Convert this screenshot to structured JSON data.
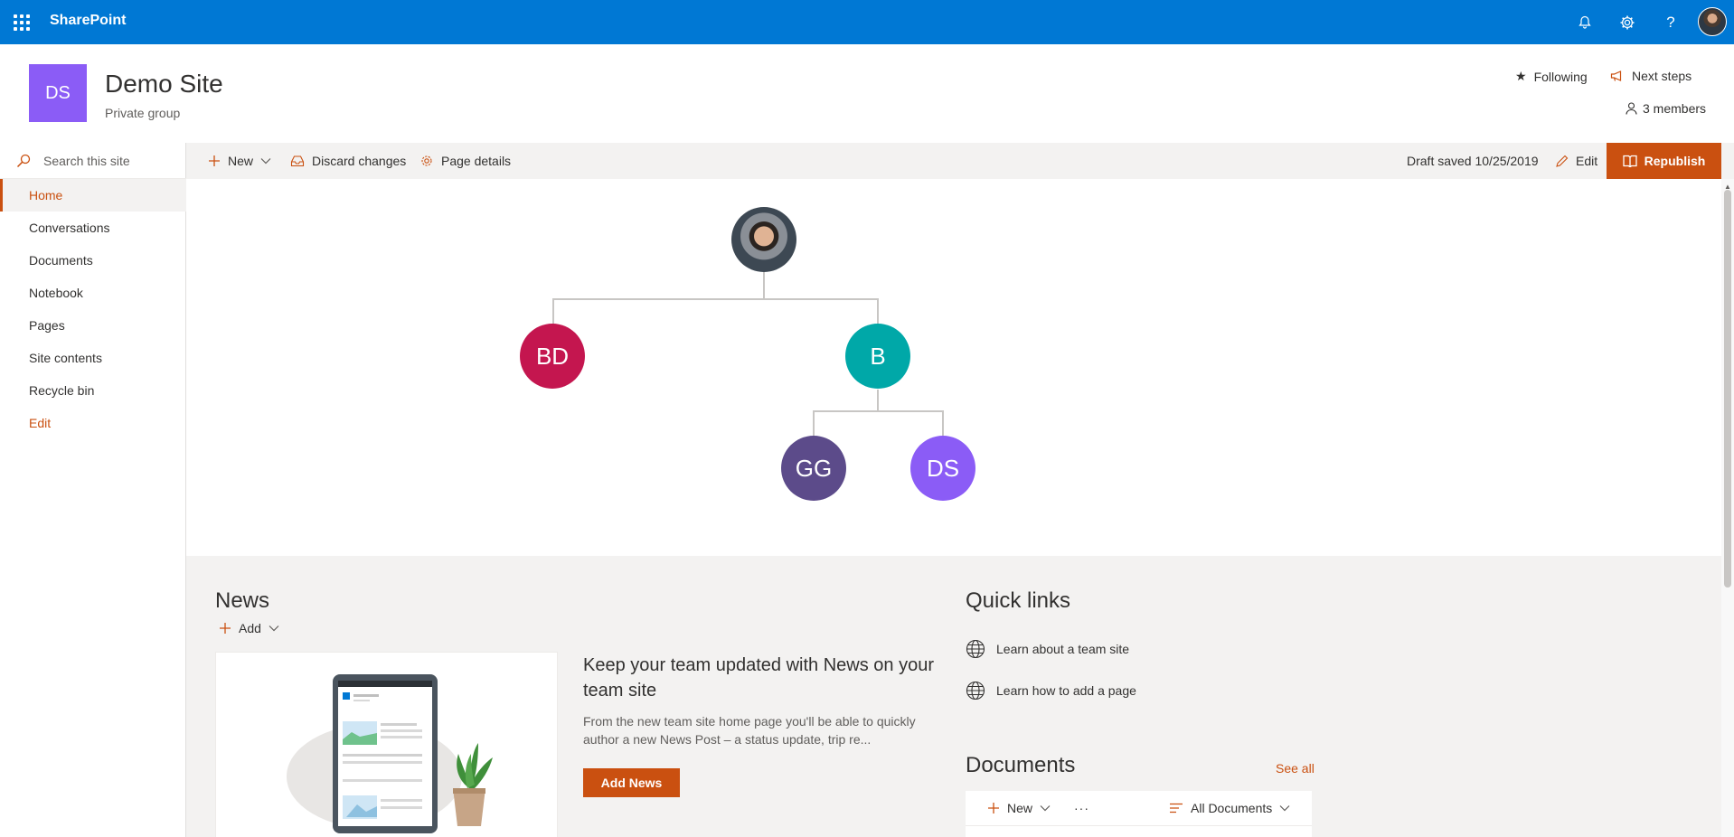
{
  "suitebar": {
    "brand": "SharePoint",
    "icons": [
      "app-launcher-icon",
      "bell-icon",
      "gear-icon",
      "help-icon",
      "avatar"
    ]
  },
  "site": {
    "logo_text": "DS",
    "title": "Demo Site",
    "subtitle": "Private group",
    "following_label": "Following",
    "next_steps_label": "Next steps",
    "members_label": "3 members"
  },
  "search": {
    "placeholder": "Search this site"
  },
  "nav": {
    "items": [
      {
        "label": "Home",
        "active": true
      },
      {
        "label": "Conversations"
      },
      {
        "label": "Documents"
      },
      {
        "label": "Notebook"
      },
      {
        "label": "Pages"
      },
      {
        "label": "Site contents"
      },
      {
        "label": "Recycle bin"
      },
      {
        "label": "Edit"
      }
    ]
  },
  "command_bar": {
    "new_label": "New",
    "discard_label": "Discard changes",
    "page_details_label": "Page details",
    "draft_status": "Draft saved 10/25/2019",
    "edit_label": "Edit",
    "republish_label": "Republish"
  },
  "org_chart": {
    "nodes": [
      {
        "initials": "BD",
        "color": "#c4164f"
      },
      {
        "initials": "B",
        "color": "#00a8a8"
      },
      {
        "initials": "GG",
        "color": "#5c4b8a"
      },
      {
        "initials": "DS",
        "color": "#8b5cf6"
      }
    ]
  },
  "news": {
    "title": "News",
    "add_label": "Add",
    "headline": "Keep your team updated with News on your team site",
    "description": "From the new team site home page you'll be able to quickly author a new News Post – a status update, trip re...",
    "add_news_label": "Add News"
  },
  "quick_links": {
    "title": "Quick links",
    "items": [
      {
        "label": "Learn about a team site"
      },
      {
        "label": "Learn how to add a page"
      }
    ]
  },
  "documents": {
    "title": "Documents",
    "see_all_label": "See all",
    "new_label": "New",
    "more_label": "···",
    "view_label": "All Documents"
  },
  "colors": {
    "suite_bar": "#0078d4",
    "accent": "#ca5010",
    "site_logo": "#8b5cf6"
  }
}
